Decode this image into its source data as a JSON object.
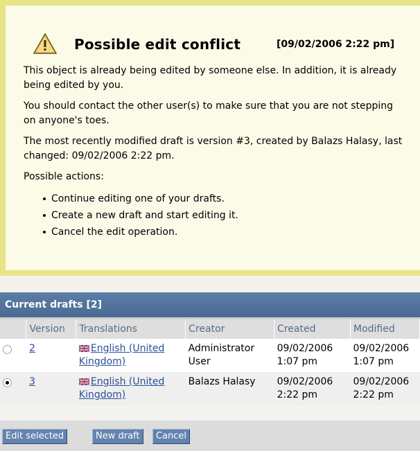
{
  "warning": {
    "title": "Possible edit conflict",
    "timestamp": "[09/02/2006 2:22 pm]",
    "paragraphs": [
      "This object is already being edited by someone else. In addition, it is already being edited by you.",
      "You should contact the other user(s) to make sure that you are not stepping on anyone's toes.",
      "The most recently modified draft is version #3, created by Balazs Halasy, last changed: 09/02/2006 2:22 pm.",
      "Possible actions:"
    ],
    "actions": [
      "Continue editing one of your drafts.",
      "Create a new draft and start editing it.",
      "Cancel the edit operation."
    ]
  },
  "drafts": {
    "header": "Current drafts [2]",
    "columns": [
      "",
      "Version",
      "Translations",
      "Creator",
      "Created",
      "Modified"
    ],
    "rows": [
      {
        "selected": false,
        "version": "2",
        "translation": "English (United Kingdom)",
        "creator": "Administrator User",
        "created": "09/02/2006 1:07 pm",
        "modified": "09/02/2006 1:07 pm"
      },
      {
        "selected": true,
        "version": "3",
        "translation": "English (United Kingdom)",
        "creator": "Balazs Halasy",
        "created": "09/02/2006 2:22 pm",
        "modified": "09/02/2006 2:22 pm"
      }
    ]
  },
  "buttons": {
    "edit_selected": "Edit selected",
    "new_draft": "New draft",
    "cancel": "Cancel"
  },
  "icons": {
    "warning": "warning-triangle-icon",
    "flag": "uk-flag-icon"
  },
  "colors": {
    "panel_header": "#5b7ea6",
    "link": "#2b4f98",
    "warning_border": "#e8e487",
    "warning_bg": "#fbfbe8"
  }
}
